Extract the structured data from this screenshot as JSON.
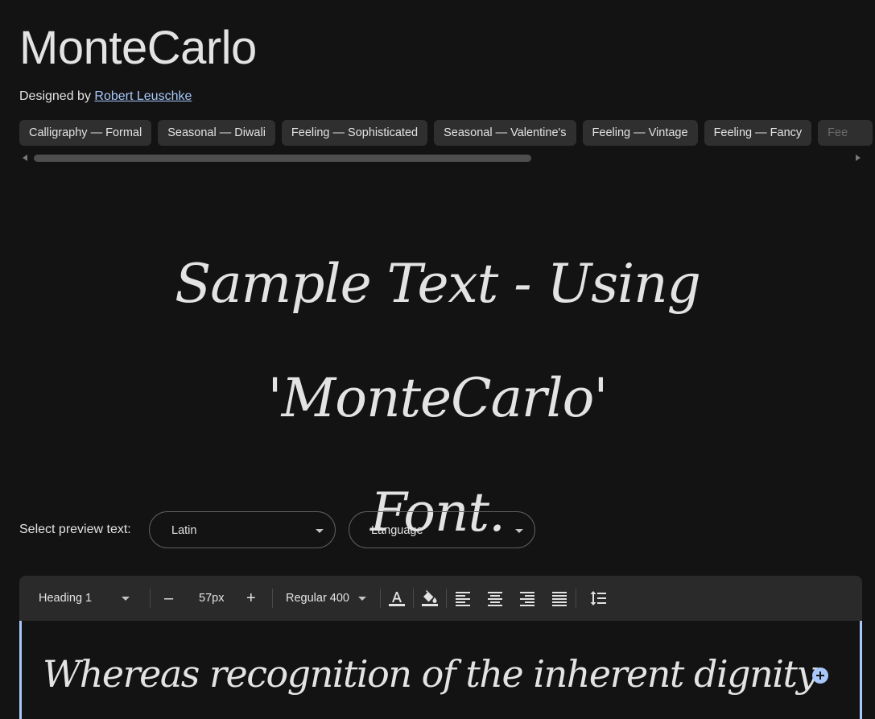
{
  "font": {
    "name": "MonteCarlo",
    "designed_by_prefix": "Designed by",
    "designer": "Robert Leuschke"
  },
  "tags": [
    "Calligraphy — Formal",
    "Seasonal — Diwali",
    "Feeling — Sophisticated",
    "Seasonal — Valentine's",
    "Feeling — Vintage",
    "Feeling — Fancy",
    "Fee"
  ],
  "hero": {
    "line1": "Sample Text - Using 'MonteCarlo'",
    "line2": "Font."
  },
  "preview": {
    "label": "Select preview text:",
    "text_select": "Latin",
    "language_select": "Language"
  },
  "toolbar": {
    "style": "Heading 1",
    "decrease": "–",
    "size": "57px",
    "increase": "+",
    "weight": "Regular 400"
  },
  "editor": {
    "text": "Whereas recognition of the inherent dignity"
  },
  "colors": {
    "background": "#131313",
    "chip": "#2f2f2f",
    "toolbar": "#2a2a2a",
    "accent": "#a8c7fa",
    "text": "#e3e3e3"
  }
}
